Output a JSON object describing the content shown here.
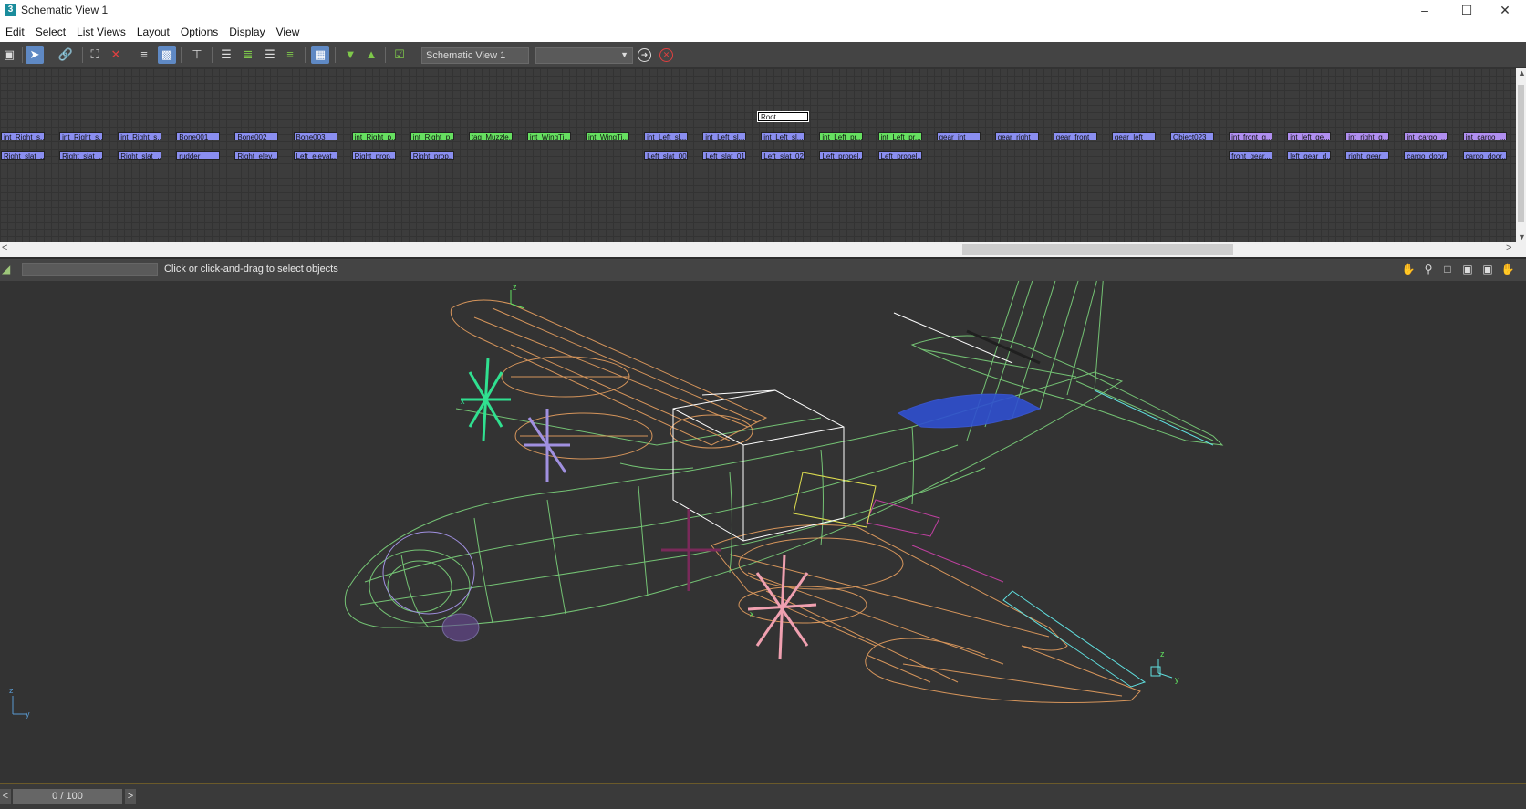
{
  "window": {
    "title": "Schematic View 1",
    "app_icon": "3"
  },
  "menu": [
    "Edit",
    "Select",
    "List Views",
    "Layout",
    "Options",
    "Display",
    "View"
  ],
  "toolbar": {
    "view_name": "Schematic View 1",
    "dropdown_value": ""
  },
  "schematic": {
    "root_label": "Root",
    "top_nodes": [
      {
        "label": "jnt_Right_s...",
        "color": "blue"
      },
      {
        "label": "jnt_Right_s...",
        "color": "blue"
      },
      {
        "label": "jnt_Right_s...",
        "color": "blue"
      },
      {
        "label": "Bone001",
        "color": "blue"
      },
      {
        "label": "Bone002",
        "color": "blue"
      },
      {
        "label": "Bone003",
        "color": "blue"
      },
      {
        "label": "jnt_Right_p...",
        "color": "green"
      },
      {
        "label": "jnt_Right_p...",
        "color": "green"
      },
      {
        "label": "tag_Muzzle...",
        "color": "green"
      },
      {
        "label": "jnt_WingTi...",
        "color": "green"
      },
      {
        "label": "jnt_WingTi...",
        "color": "green"
      },
      {
        "label": "jnt_Left_sl...",
        "color": "blue"
      },
      {
        "label": "jnt_Left_sl...",
        "color": "blue"
      },
      {
        "label": "jnt_Left_sl...",
        "color": "blue"
      },
      {
        "label": "jnt_Left_pr...",
        "color": "green"
      },
      {
        "label": "jnt_Left_pr...",
        "color": "green"
      },
      {
        "label": "gear_jnt",
        "color": "blue"
      },
      {
        "label": "gear_right",
        "color": "blue"
      },
      {
        "label": "gear_front",
        "color": "blue"
      },
      {
        "label": "gear_left",
        "color": "blue"
      },
      {
        "label": "Object023",
        "color": "blue"
      },
      {
        "label": "jnt_front_g...",
        "color": "purple"
      },
      {
        "label": "jnt_left_ge...",
        "color": "purple"
      },
      {
        "label": "jnt_right_g...",
        "color": "purple"
      },
      {
        "label": "jnt_cargo_...",
        "color": "purple"
      },
      {
        "label": "jnt_cargo_...",
        "color": "purple"
      }
    ],
    "bottom_nodes": [
      {
        "label": "Right_slat_...",
        "col": 0,
        "color": "blue"
      },
      {
        "label": "Right_slat_...",
        "col": 1,
        "color": "blue"
      },
      {
        "label": "Right_slat_...",
        "col": 2,
        "color": "blue"
      },
      {
        "label": "rudder",
        "col": 3,
        "color": "blue"
      },
      {
        "label": "Right_elev...",
        "col": 4,
        "color": "blue"
      },
      {
        "label": "Left_elevat...",
        "col": 5,
        "color": "blue"
      },
      {
        "label": "Right_prop...",
        "col": 6,
        "color": "blue"
      },
      {
        "label": "Right_prop...",
        "col": 7,
        "color": "blue"
      },
      {
        "label": "Left_slat_00",
        "col": 11,
        "color": "blue"
      },
      {
        "label": "Left_slat_01",
        "col": 12,
        "color": "blue"
      },
      {
        "label": "Left_slat_02",
        "col": 13,
        "color": "blue"
      },
      {
        "label": "Left_propel...",
        "col": 14,
        "color": "blue"
      },
      {
        "label": "Left_propel...",
        "col": 15,
        "color": "blue"
      },
      {
        "label": "front_gear...",
        "col": 21,
        "color": "blue"
      },
      {
        "label": "left_gear_d...",
        "col": 22,
        "color": "blue"
      },
      {
        "label": "right_gear_...",
        "col": 23,
        "color": "blue"
      },
      {
        "label": "cargo_door...",
        "col": 24,
        "color": "blue"
      },
      {
        "label": "cargo_door...",
        "col": 25,
        "color": "blue"
      }
    ]
  },
  "status": {
    "prompt": "Click or click-and-drag to select objects"
  },
  "viewport": {
    "axis_labels": {
      "x": "x",
      "y": "y",
      "z": "z"
    }
  },
  "timeline": {
    "frame": "0 / 100",
    "prev": "<",
    "next": ">"
  },
  "colors": {
    "wire_green": "#7cd37c",
    "wire_orange": "#e8a060",
    "wire_cyan": "#60e0e0",
    "wire_blue": "#3a58d8",
    "wire_pink": "#f0a0b0",
    "wire_purple": "#a090e0",
    "wire_magenta": "#c040a0"
  }
}
